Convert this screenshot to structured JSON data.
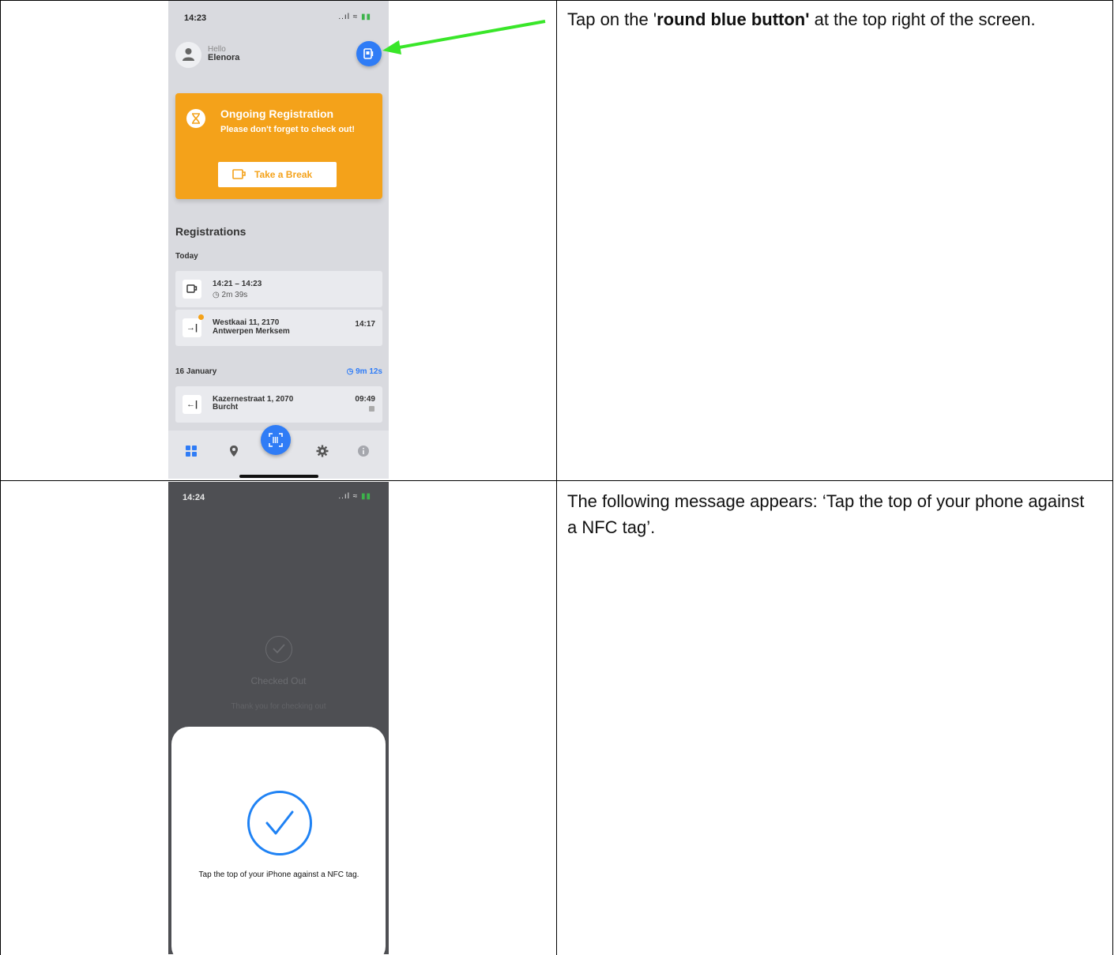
{
  "row1": {
    "instruction_before": "Tap on the '",
    "instruction_bold": "round blue button'",
    "instruction_after": " at the top right of the screen.",
    "phone": {
      "status_time": "14:23",
      "status_icons": "..ıl ≈",
      "greeting": "Hello",
      "user_name": "Elenora",
      "card_title": "Ongoing Registration",
      "card_subtitle": "Please don't forget to check out!",
      "break_button": "Take a Break",
      "section_title": "Registrations",
      "today_label": "Today",
      "reg1_times": "14:21  –  14:23",
      "reg1_duration": "◷ 2m 39s",
      "reg2_line1": "Westkaai 11, 2170",
      "reg2_line2": "Antwerpen Merksem",
      "reg2_time": "14:17",
      "day2_label": "16 January",
      "day2_duration": "◷ 9m 12s",
      "reg3_line1": "Kazernestraat 1, 2070",
      "reg3_line2": "Burcht",
      "reg3_time": "09:49"
    },
    "arrow_color": "#39e629"
  },
  "row2": {
    "instruction": "The following message appears: ‘Tap the top of your phone against a NFC tag’.",
    "phone": {
      "status_time": "14:24",
      "status_icons": "..ıl ≈",
      "bg_title": "Checked Out",
      "bg_subtitle": "Thank you for checking out",
      "sheet_message": "Tap the top of your iPhone against a NFC tag."
    }
  }
}
